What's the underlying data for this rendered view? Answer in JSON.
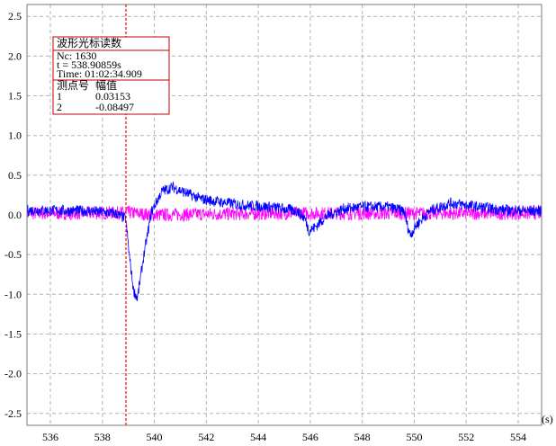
{
  "chart_data": {
    "type": "line",
    "x_unit_label": "(s)",
    "xlim": [
      535.1,
      554.9
    ],
    "ylim": [
      -2.65,
      2.65
    ],
    "x_ticks": [
      "536",
      "538",
      "540",
      "542",
      "544",
      "546",
      "548",
      "550",
      "552",
      "554"
    ],
    "y_ticks": [
      "2.5",
      "2.0",
      "1.5",
      "1.0",
      "0.5",
      "0.0",
      "-0.5",
      "-1.0",
      "-1.5",
      "-2.0",
      "-2.5"
    ],
    "grid": true,
    "cursor_x": 538.90859,
    "series": [
      {
        "color": "#ff00ff",
        "x": [
          535.1,
          537.0,
          539.0,
          540.0,
          542.0,
          545.0,
          548.0,
          551.0,
          554.9
        ],
        "y": [
          0.02,
          0.02,
          0.03,
          0.0,
          0.01,
          0.02,
          0.02,
          0.02,
          0.02
        ]
      },
      {
        "color": "#0000ff",
        "x": [
          535.1,
          537.5,
          538.5,
          538.9,
          539.05,
          539.2,
          539.35,
          539.6,
          539.9,
          540.3,
          540.7,
          541.2,
          541.8,
          542.6,
          543.5,
          544.5,
          545.5,
          545.8,
          545.95,
          546.2,
          546.6,
          547.3,
          548.0,
          549.0,
          549.6,
          549.75,
          549.85,
          550.1,
          550.6,
          551.4,
          552.5,
          553.5,
          554.9
        ],
        "y": [
          0.06,
          0.05,
          0.02,
          -0.05,
          -0.55,
          -0.95,
          -1.05,
          -0.5,
          0.05,
          0.3,
          0.35,
          0.28,
          0.2,
          0.16,
          0.12,
          0.1,
          0.05,
          -0.05,
          -0.2,
          -0.15,
          -0.02,
          0.08,
          0.1,
          0.1,
          0.05,
          -0.15,
          -0.25,
          -0.12,
          0.05,
          0.15,
          0.1,
          0.06,
          0.05
        ]
      }
    ]
  },
  "info_box": {
    "title": "波形光标读数",
    "nc": "Nc: 1630",
    "t": "t = 538.90859s",
    "time": "Time: 01:02:34.909",
    "headers": [
      "测点号",
      "幅值"
    ],
    "rows": [
      [
        "1",
        "0.03153"
      ],
      [
        "2",
        "-0.08497"
      ]
    ]
  },
  "colors": {
    "grid": "#b4b4b4",
    "cursor": "#ff0000",
    "info_border": "#c00000"
  }
}
